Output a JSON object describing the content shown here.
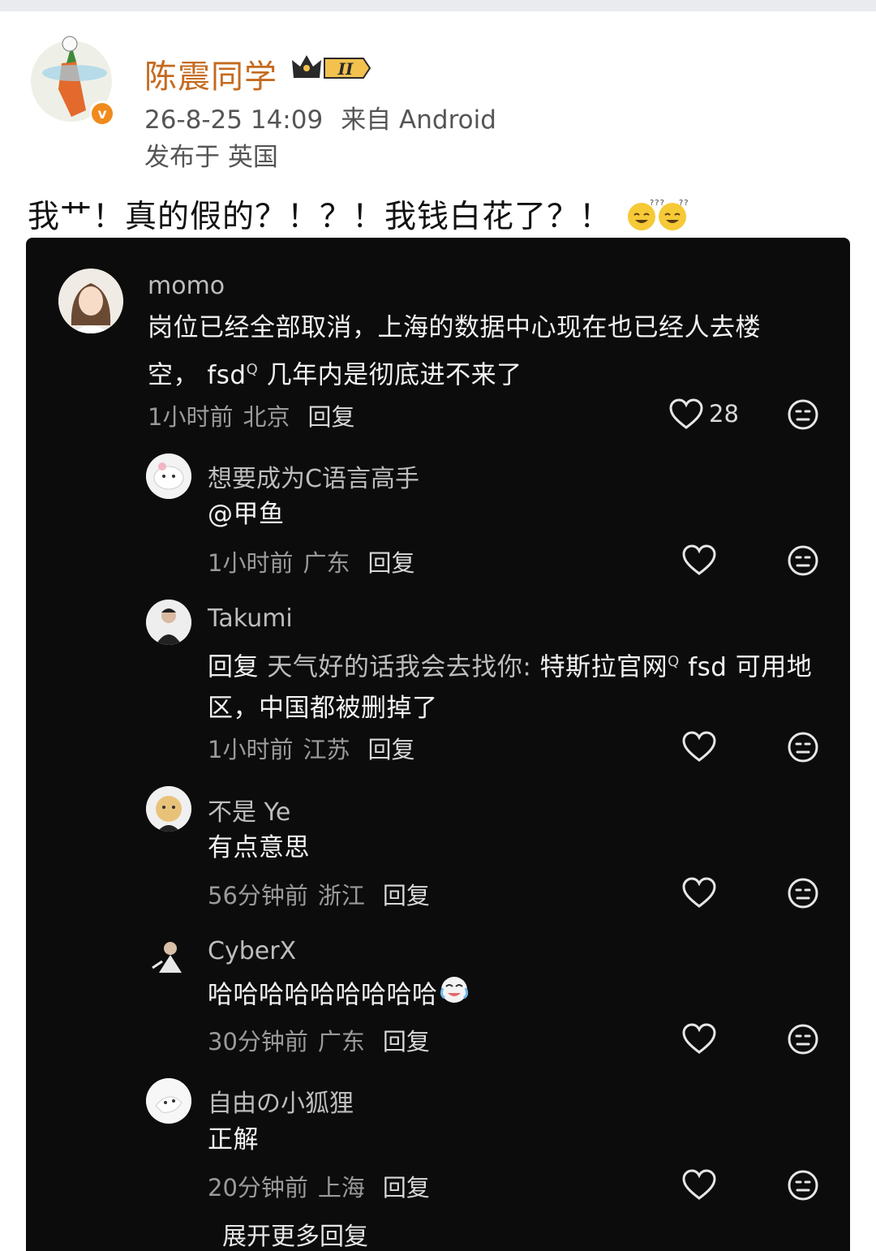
{
  "post": {
    "author": "陈震同学",
    "badge_level": "II",
    "time": "26-8-25 14:09",
    "source": "来自 Android",
    "location": "发布于 英国",
    "text": "我艹！真的假的？！？！我钱白花了？！"
  },
  "comment_thread": {
    "main": {
      "user": "momo",
      "text_line1": "岗位已经全部取消，上海的数据中心现在也已经人去楼",
      "text_line2_a": "空，",
      "text_line2_b": "fsd",
      "text_line2_c": "几年内是彻底进不来了",
      "time": "1小时前",
      "location": "北京",
      "reply_label": "回复",
      "likes": "28"
    },
    "replies": [
      {
        "user": "想要成为C语言高手",
        "text": "@甲鱼",
        "time": "1小时前",
        "location": "广东",
        "reply_label": "回复"
      },
      {
        "user": "Takumi",
        "text_prefix": "回复",
        "text_target": "天气好的话我会去找你:",
        "text_a": "特斯拉官网",
        "text_b": "fsd 可用地",
        "text_line2": "区，中国都被删掉了",
        "time": "1小时前",
        "location": "江苏",
        "reply_label": "回复"
      },
      {
        "user": "不是 Ye",
        "text": "有点意思",
        "time": "56分钟前",
        "location": "浙江",
        "reply_label": "回复"
      },
      {
        "user": "CyberX",
        "text": "哈哈哈哈哈哈哈哈哈",
        "time": "30分钟前",
        "location": "广东",
        "reply_label": "回复"
      },
      {
        "user": "自由の小狐狸",
        "text": "正解",
        "time": "20分钟前",
        "location": "上海",
        "reply_label": "回复"
      }
    ],
    "expand_label": "展开更多回复"
  },
  "colors": {
    "author_name": "#c56a1f",
    "card_bg": "#0c0c0c",
    "verified": "#f08a1c"
  },
  "icons": [
    "heart-icon",
    "meh-face-icon",
    "search-superscript-icon",
    "crown-badge-icon",
    "verified-badge-icon",
    "sweat-smile-emoji",
    "crying-laugh-emoji"
  ]
}
